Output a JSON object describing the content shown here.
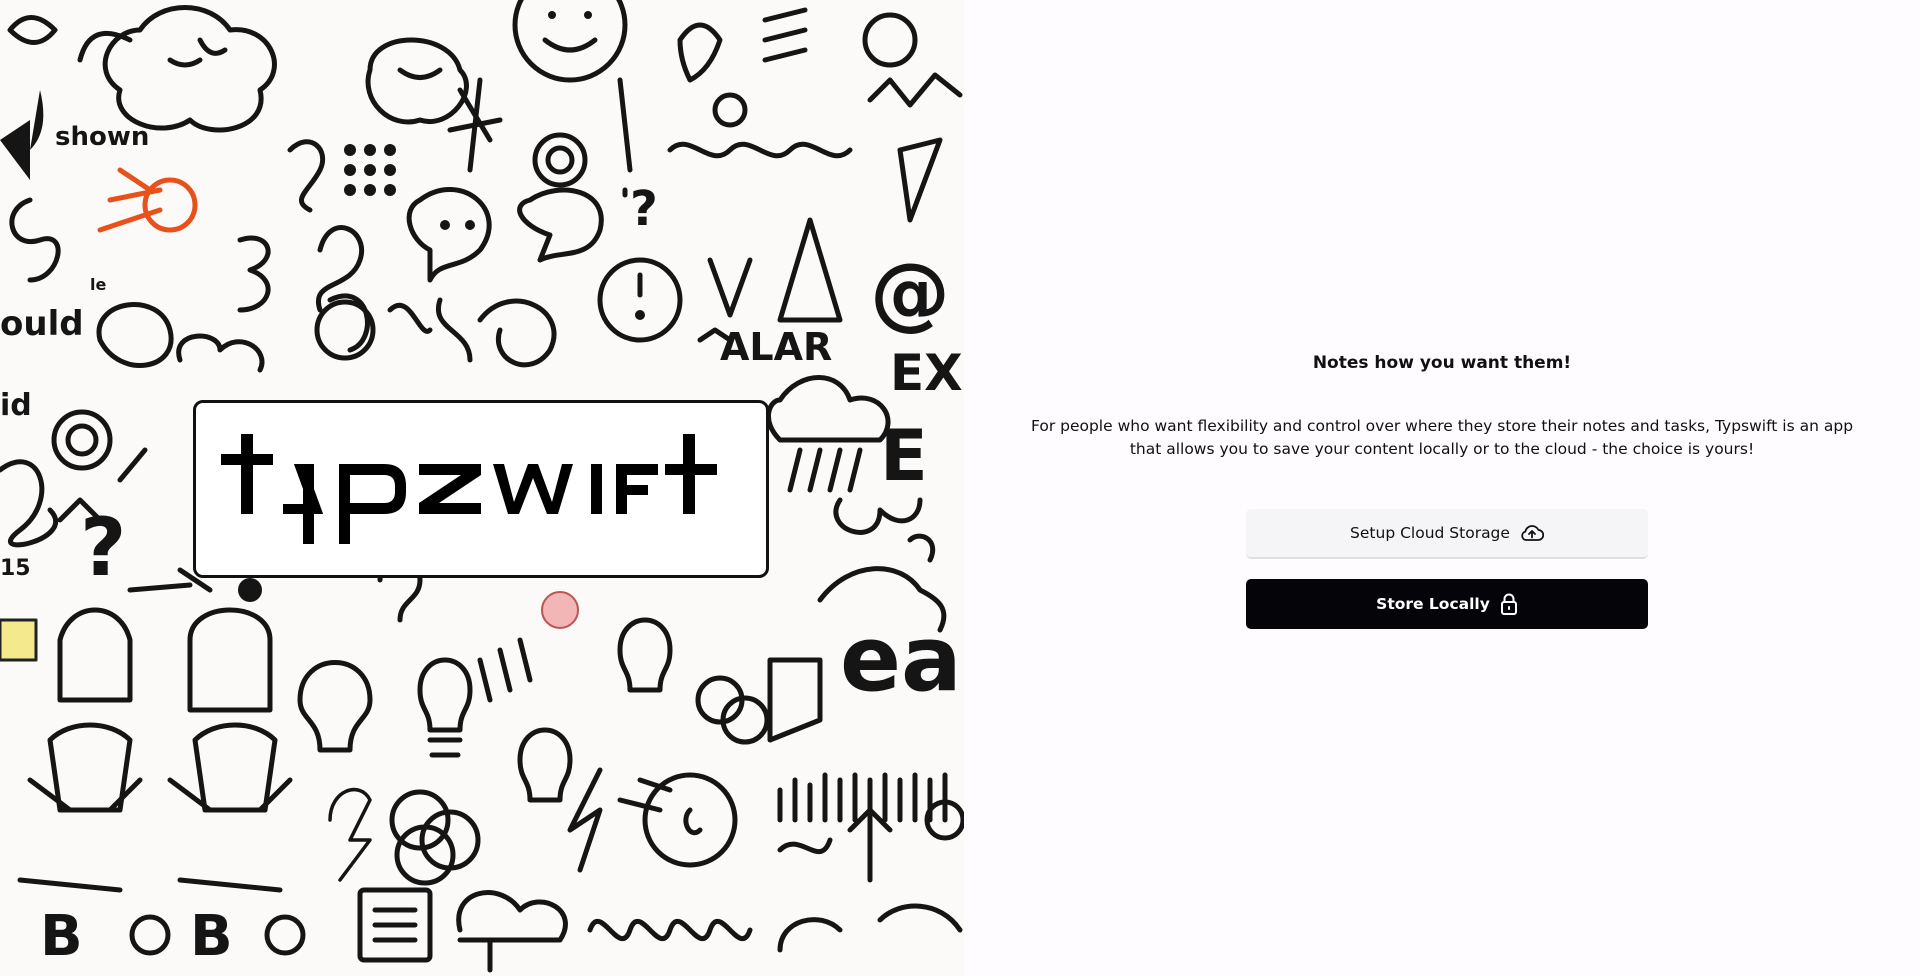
{
  "brand": {
    "logo_text": "typswift"
  },
  "main": {
    "headline": "Notes how you want them!",
    "description": "For people who want flexibility and control over where they store their notes and tasks, Typswift is an app that allows you to save your content locally or to the cloud - the choice is yours!"
  },
  "actions": {
    "cloud_label": "Setup Cloud Storage",
    "cloud_icon": "cloud-upload-icon",
    "local_label": "Store Locally",
    "local_icon": "lock-icon"
  },
  "illustration": {
    "doodle_texts": [
      "shown",
      "ould",
      "id",
      "ALAR",
      "EXI",
      "ea",
      "15"
    ]
  },
  "colors": {
    "page_background": "#fefcfe",
    "primary_button": "#050408",
    "secondary_button": "#f5f4f6",
    "accent_orange": "#e8501c"
  }
}
